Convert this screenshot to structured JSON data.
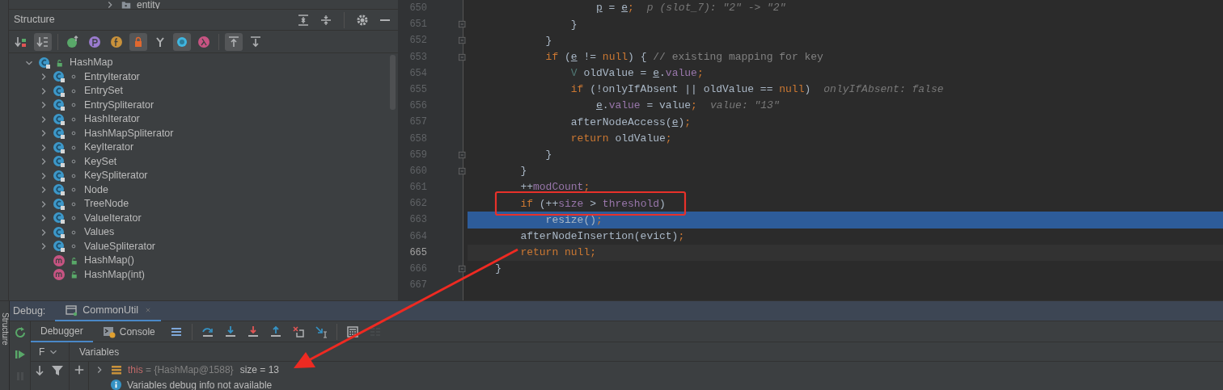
{
  "project_tree": {
    "items": [
      {
        "label": "entity",
        "expanded": false
      }
    ]
  },
  "structure": {
    "title": "Structure",
    "toolbar": [
      {
        "kind": "sort-visibility",
        "toggled": false
      },
      {
        "kind": "sort-alpha",
        "toggled": true
      },
      {
        "kind": "inherited",
        "toggled": false
      },
      {
        "kind": "properties",
        "toggled": false
      },
      {
        "kind": "fields",
        "toggled": false
      },
      {
        "kind": "non-public",
        "toggled": true
      },
      {
        "kind": "fork",
        "toggled": false
      },
      {
        "kind": "anonymous",
        "toggled": true
      },
      {
        "kind": "lambda",
        "toggled": false
      },
      {
        "kind": "scroll-to",
        "toggled": true
      },
      {
        "kind": "scroll-from",
        "toggled": false
      }
    ],
    "tree": [
      {
        "label": "HashMap",
        "kind": "class",
        "expanded": true,
        "children": [
          {
            "label": "EntryIterator",
            "kind": "inner-class",
            "expanded": false
          },
          {
            "label": "EntrySet",
            "kind": "inner-class",
            "expanded": false
          },
          {
            "label": "EntrySpliterator",
            "kind": "inner-class",
            "expanded": false
          },
          {
            "label": "HashIterator",
            "kind": "inner-class",
            "expanded": false
          },
          {
            "label": "HashMapSpliterator",
            "kind": "inner-class",
            "expanded": false
          },
          {
            "label": "KeyIterator",
            "kind": "inner-class",
            "expanded": false
          },
          {
            "label": "KeySet",
            "kind": "inner-class",
            "expanded": false
          },
          {
            "label": "KeySpliterator",
            "kind": "inner-class",
            "expanded": false
          },
          {
            "label": "Node",
            "kind": "inner-class",
            "expanded": false
          },
          {
            "label": "TreeNode",
            "kind": "inner-class",
            "expanded": false
          },
          {
            "label": "ValueIterator",
            "kind": "inner-class",
            "expanded": false
          },
          {
            "label": "Values",
            "kind": "inner-class",
            "expanded": false
          },
          {
            "label": "ValueSpliterator",
            "kind": "inner-class",
            "expanded": false
          },
          {
            "label": "HashMap()",
            "kind": "method"
          },
          {
            "label": "HashMap(int)",
            "kind": "method"
          }
        ]
      }
    ]
  },
  "editor": {
    "lines": [
      {
        "number": "650",
        "kind": "normal",
        "fold": false,
        "tokens": [
          {
            "text": "                    p",
            "kind": "local"
          },
          {
            "text": " = ",
            "kind": "plain"
          },
          {
            "text": "e",
            "kind": "local"
          },
          {
            "text": ";",
            "kind": "punct"
          },
          {
            "text": "p (slot_7): \"2\" -> \"2\"",
            "kind": "hint"
          }
        ]
      },
      {
        "number": "651",
        "kind": "normal",
        "fold": true,
        "tokens": [
          {
            "text": "                }",
            "kind": "plain"
          }
        ]
      },
      {
        "number": "652",
        "kind": "normal",
        "fold": true,
        "tokens": [
          {
            "text": "            }",
            "kind": "plain"
          }
        ]
      },
      {
        "number": "653",
        "kind": "normal",
        "fold": true,
        "tokens": [
          {
            "text": "            if",
            "kind": "keyword"
          },
          {
            "text": " (",
            "kind": "plain"
          },
          {
            "text": "e",
            "kind": "local"
          },
          {
            "text": " != ",
            "kind": "plain"
          },
          {
            "text": "null",
            "kind": "keyword"
          },
          {
            "text": ") { ",
            "kind": "plain"
          },
          {
            "text": "// existing mapping for key",
            "kind": "comment"
          }
        ]
      },
      {
        "number": "654",
        "kind": "normal",
        "fold": false,
        "tokens": [
          {
            "text": "                V",
            "kind": "type"
          },
          {
            "text": " oldValue = ",
            "kind": "plain"
          },
          {
            "text": "e",
            "kind": "local"
          },
          {
            "text": ".",
            "kind": "plain"
          },
          {
            "text": "value",
            "kind": "field"
          },
          {
            "text": ";",
            "kind": "punct"
          }
        ]
      },
      {
        "number": "655",
        "kind": "normal",
        "fold": false,
        "tokens": [
          {
            "text": "                if",
            "kind": "keyword"
          },
          {
            "text": " (!onlyIfAbsent || oldValue == ",
            "kind": "plain"
          },
          {
            "text": "null",
            "kind": "keyword"
          },
          {
            "text": ")",
            "kind": "plain"
          },
          {
            "text": "onlyIfAbsent: false",
            "kind": "hint"
          }
        ]
      },
      {
        "number": "656",
        "kind": "normal",
        "fold": false,
        "tokens": [
          {
            "text": "                    e",
            "kind": "local"
          },
          {
            "text": ".",
            "kind": "plain"
          },
          {
            "text": "value",
            "kind": "field"
          },
          {
            "text": " = value",
            "kind": "plain"
          },
          {
            "text": ";",
            "kind": "punct"
          },
          {
            "text": "value: \"13\"",
            "kind": "hint"
          }
        ]
      },
      {
        "number": "657",
        "kind": "normal",
        "fold": false,
        "tokens": [
          {
            "text": "                afterNodeAccess(",
            "kind": "plain"
          },
          {
            "text": "e",
            "kind": "local"
          },
          {
            "text": ")",
            "kind": "plain"
          },
          {
            "text": ";",
            "kind": "punct"
          }
        ]
      },
      {
        "number": "658",
        "kind": "normal",
        "fold": false,
        "tokens": [
          {
            "text": "                return",
            "kind": "keyword"
          },
          {
            "text": " oldValue",
            "kind": "plain"
          },
          {
            "text": ";",
            "kind": "punct"
          }
        ]
      },
      {
        "number": "659",
        "kind": "normal",
        "fold": true,
        "tokens": [
          {
            "text": "            }",
            "kind": "plain"
          }
        ]
      },
      {
        "number": "660",
        "kind": "normal",
        "fold": true,
        "tokens": [
          {
            "text": "        }",
            "kind": "plain"
          }
        ]
      },
      {
        "number": "661",
        "kind": "normal",
        "fold": false,
        "tokens": [
          {
            "text": "        ++",
            "kind": "plain"
          },
          {
            "text": "modCount",
            "kind": "field"
          },
          {
            "text": ";",
            "kind": "punct"
          }
        ]
      },
      {
        "number": "662",
        "kind": "normal",
        "fold": false,
        "tokens": [
          {
            "text": "        if",
            "kind": "keyword"
          },
          {
            "text": " (++",
            "kind": "plain"
          },
          {
            "text": "size",
            "kind": "field"
          },
          {
            "text": " > ",
            "kind": "plain"
          },
          {
            "text": "threshold",
            "kind": "field"
          },
          {
            "text": ")",
            "kind": "plain"
          }
        ]
      },
      {
        "number": "663",
        "kind": "execution",
        "fold": false,
        "tokens": [
          {
            "text": "            resize()",
            "kind": "plain"
          },
          {
            "text": ";",
            "kind": "punct"
          }
        ]
      },
      {
        "number": "664",
        "kind": "normal",
        "fold": false,
        "tokens": [
          {
            "text": "        afterNodeInsertion(evict)",
            "kind": "plain"
          },
          {
            "text": ";",
            "kind": "punct"
          }
        ]
      },
      {
        "number": "665",
        "kind": "caret",
        "fold": false,
        "tokens": [
          {
            "text": "        return",
            "kind": "keyword"
          },
          {
            "text": " null",
            "kind": "keyword"
          },
          {
            "text": ";",
            "kind": "punct"
          }
        ]
      },
      {
        "number": "666",
        "kind": "normal",
        "fold": true,
        "tokens": [
          {
            "text": "    }",
            "kind": "plain"
          }
        ]
      },
      {
        "number": "667",
        "kind": "normal",
        "fold": false
      }
    ]
  },
  "side_bar": {
    "label": "Structure"
  },
  "debug": {
    "title": "Debug:",
    "sessions": [
      {
        "label": "CommonUtil",
        "selected": true
      }
    ],
    "side_controls": [
      {
        "kind": "rerun",
        "disabled": false
      },
      {
        "kind": "resume",
        "disabled": false
      },
      {
        "kind": "pause",
        "disabled": true
      }
    ],
    "tabs": [
      {
        "label": "Debugger",
        "kind": "debugger",
        "selected": true
      },
      {
        "label": "Console",
        "kind": "console",
        "selected": false
      }
    ],
    "toolbar": [
      {
        "kind": "layout",
        "disabled": false
      },
      {
        "kind": "step-over",
        "disabled": false
      },
      {
        "kind": "step-into",
        "disabled": false
      },
      {
        "kind": "force-step-into",
        "disabled": false
      },
      {
        "kind": "step-out",
        "disabled": false
      },
      {
        "kind": "drop-frame",
        "disabled": false
      },
      {
        "kind": "run-to-cursor",
        "disabled": false
      },
      {
        "kind": "evaluate",
        "disabled": false
      },
      {
        "kind": "trace",
        "disabled": true
      }
    ],
    "frames_header": "F",
    "variables_header": "Variables",
    "variables": [
      {
        "kind": "object",
        "expanded": false,
        "tokens": [
          {
            "text": "this",
            "kind": "name"
          },
          {
            "text": " = ",
            "kind": "op"
          },
          {
            "text": "{HashMap@1588}",
            "kind": "ref"
          },
          {
            "text": "size = 13",
            "kind": "value"
          }
        ]
      },
      {
        "kind": "info",
        "tokens": [
          {
            "text": "Variables debug info not available",
            "kind": "value"
          }
        ]
      }
    ]
  }
}
